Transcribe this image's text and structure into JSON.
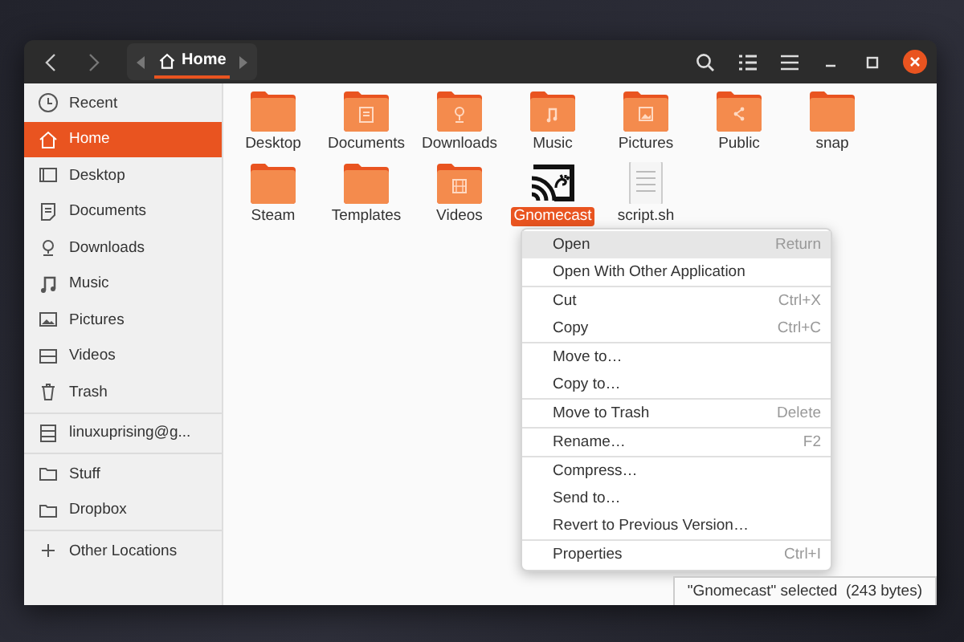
{
  "header": {
    "path": "Home"
  },
  "sidebar": {
    "groups": [
      [
        {
          "label": "Recent",
          "kind": "recent",
          "selected": false
        },
        {
          "label": "Home",
          "kind": "home",
          "selected": true
        },
        {
          "label": "Desktop",
          "kind": "desktop",
          "selected": false
        },
        {
          "label": "Documents",
          "kind": "documents",
          "selected": false
        },
        {
          "label": "Downloads",
          "kind": "downloads",
          "selected": false
        },
        {
          "label": "Music",
          "kind": "music",
          "selected": false
        },
        {
          "label": "Pictures",
          "kind": "pictures",
          "selected": false
        },
        {
          "label": "Videos",
          "kind": "videos",
          "selected": false
        },
        {
          "label": "Trash",
          "kind": "trash",
          "selected": false
        }
      ],
      [
        {
          "label": "linuxuprising@g...",
          "kind": "drive",
          "selected": false
        }
      ],
      [
        {
          "label": "Stuff",
          "kind": "folder",
          "selected": false
        },
        {
          "label": "Dropbox",
          "kind": "folder",
          "selected": false
        }
      ],
      [
        {
          "label": "Other Locations",
          "kind": "add",
          "selected": false
        }
      ]
    ]
  },
  "files": [
    {
      "name": "Desktop",
      "kind": "folder",
      "selected": false
    },
    {
      "name": "Documents",
      "kind": "documents",
      "selected": false
    },
    {
      "name": "Downloads",
      "kind": "downloads",
      "selected": false
    },
    {
      "name": "Music",
      "kind": "music",
      "selected": false
    },
    {
      "name": "Pictures",
      "kind": "pictures",
      "selected": false
    },
    {
      "name": "Public",
      "kind": "public",
      "selected": false
    },
    {
      "name": "snap",
      "kind": "folder",
      "selected": false
    },
    {
      "name": "Steam",
      "kind": "folder",
      "selected": false
    },
    {
      "name": "Templates",
      "kind": "folder",
      "selected": false
    },
    {
      "name": "Videos",
      "kind": "videos",
      "selected": false
    },
    {
      "name": "Gnomecast",
      "kind": "app",
      "selected": true
    },
    {
      "name": "script.sh",
      "kind": "script",
      "selected": false
    }
  ],
  "context_menu": {
    "groups": [
      [
        {
          "label": "Open",
          "shortcut": "Return",
          "selected": true
        },
        {
          "label": "Open With Other Application",
          "selected": false
        }
      ],
      [
        {
          "label": "Cut",
          "shortcut": "Ctrl+X",
          "selected": false
        },
        {
          "label": "Copy",
          "shortcut": "Ctrl+C",
          "selected": false
        }
      ],
      [
        {
          "label": "Move to…",
          "selected": false
        },
        {
          "label": "Copy to…",
          "selected": false
        }
      ],
      [
        {
          "label": "Move to Trash",
          "shortcut": "Delete",
          "selected": false
        }
      ],
      [
        {
          "label": "Rename…",
          "shortcut": "F2",
          "selected": false
        }
      ],
      [
        {
          "label": "Compress…",
          "selected": false
        },
        {
          "label": "Send to…",
          "selected": false
        },
        {
          "label": "Revert to Previous Version…",
          "selected": false
        }
      ],
      [
        {
          "label": "Properties",
          "shortcut": "Ctrl+I",
          "selected": false
        }
      ]
    ]
  },
  "status_bar": "\"Gnomecast\" selected  (243 bytes)"
}
